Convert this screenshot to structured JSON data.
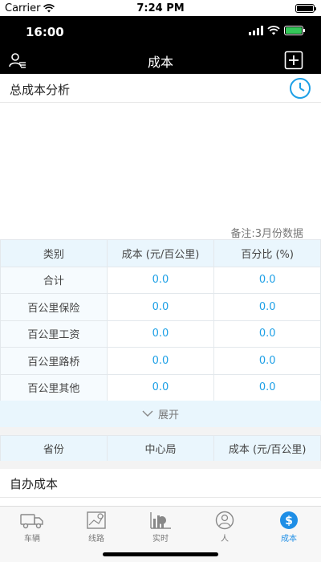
{
  "os_status": {
    "carrier": "Carrier",
    "time": "7:24 PM"
  },
  "inner_status": {
    "time": "16:00"
  },
  "navbar": {
    "title": "成本"
  },
  "analysis": {
    "title": "总成本分析",
    "note": "备注:3月份数据"
  },
  "cost_table": {
    "headers": [
      "类别",
      "成本 (元/百公里)",
      "百分比 (%)"
    ],
    "rows": [
      {
        "label": "合计",
        "cost": "0.0",
        "percent": "0.0"
      },
      {
        "label": "百公里保险",
        "cost": "0.0",
        "percent": "0.0"
      },
      {
        "label": "百公里工资",
        "cost": "0.0",
        "percent": "0.0"
      },
      {
        "label": "百公里路桥",
        "cost": "0.0",
        "percent": "0.0"
      },
      {
        "label": "百公里其他",
        "cost": "0.0",
        "percent": "0.0"
      }
    ],
    "expand_label": "展开"
  },
  "province_table": {
    "headers": [
      "省份",
      "中心局",
      "成本 (元/百公里)"
    ]
  },
  "self_cost": {
    "title": "自办成本"
  },
  "tabs": [
    {
      "label": "车辆",
      "icon": "truck-icon"
    },
    {
      "label": "线路",
      "icon": "map-icon"
    },
    {
      "label": "实时",
      "icon": "chart-icon"
    },
    {
      "label": "人",
      "icon": "person-icon"
    },
    {
      "label": "成本",
      "icon": "dollar-icon",
      "active": true
    }
  ],
  "colors": {
    "accent": "#1ea0e6",
    "header_bg": "#eaf6fd"
  }
}
